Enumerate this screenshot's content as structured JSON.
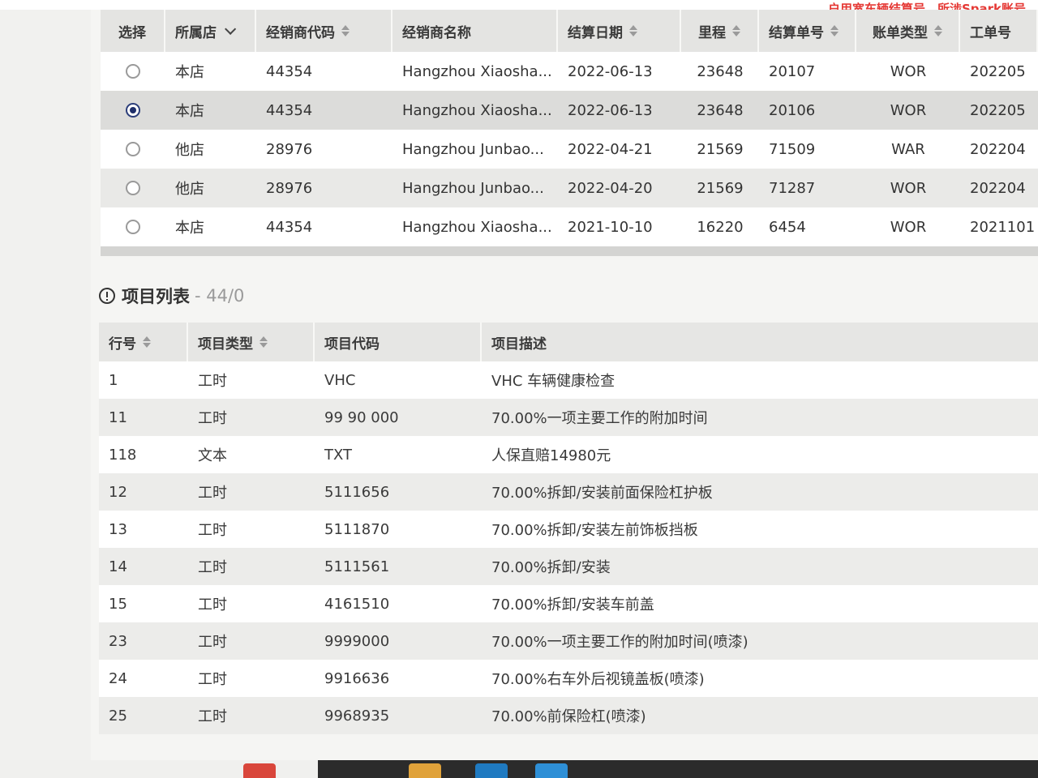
{
  "notice": "…户用宽车辆结算号，所涉Spark账号…",
  "settlement": {
    "columns": {
      "select": "选择",
      "store": "所属店",
      "dealer_code": "经销商代码",
      "dealer_name": "经销商名称",
      "settle_date": "结算日期",
      "mileage": "里程",
      "settle_no": "结算单号",
      "bill_type": "账单类型",
      "wo_no": "工单号"
    },
    "selected_index": 1,
    "rows": [
      {
        "store": "本店",
        "dealer_code": "44354",
        "dealer_name": "Hangzhou Xiaosha...",
        "settle_date": "2022-06-13",
        "mileage": "23648",
        "settle_no": "20107",
        "bill_type": "WOR",
        "wo_no": "202205"
      },
      {
        "store": "本店",
        "dealer_code": "44354",
        "dealer_name": "Hangzhou Xiaosha...",
        "settle_date": "2022-06-13",
        "mileage": "23648",
        "settle_no": "20106",
        "bill_type": "WOR",
        "wo_no": "202205"
      },
      {
        "store": "他店",
        "dealer_code": "28976",
        "dealer_name": "Hangzhou Junbao...",
        "settle_date": "2022-04-21",
        "mileage": "21569",
        "settle_no": "71509",
        "bill_type": "WAR",
        "wo_no": "202204"
      },
      {
        "store": "他店",
        "dealer_code": "28976",
        "dealer_name": "Hangzhou Junbao...",
        "settle_date": "2022-04-20",
        "mileage": "21569",
        "settle_no": "71287",
        "bill_type": "WOR",
        "wo_no": "202204"
      },
      {
        "store": "本店",
        "dealer_code": "44354",
        "dealer_name": "Hangzhou Xiaosha...",
        "settle_date": "2021-10-10",
        "mileage": "16220",
        "settle_no": "6454",
        "bill_type": "WOR",
        "wo_no": "2021101"
      }
    ]
  },
  "items": {
    "title": "项目列表",
    "count": "- 44/0",
    "columns": {
      "line_no": "行号",
      "item_type": "项目类型",
      "item_code": "项目代码",
      "item_desc": "项目描述"
    },
    "rows": [
      {
        "line_no": "1",
        "item_type": "工时",
        "item_code": "VHC",
        "item_desc": "VHC 车辆健康检查"
      },
      {
        "line_no": "11",
        "item_type": "工时",
        "item_code": "99 90 000",
        "item_desc": "70.00%一项主要工作的附加时间"
      },
      {
        "line_no": "118",
        "item_type": "文本",
        "item_code": "TXT",
        "item_desc": "人保直赔14980元"
      },
      {
        "line_no": "12",
        "item_type": "工时",
        "item_code": "5111656",
        "item_desc": "70.00%拆卸/安装前面保险杠护板"
      },
      {
        "line_no": "13",
        "item_type": "工时",
        "item_code": "5111870",
        "item_desc": "70.00%拆卸/安装左前饰板挡板"
      },
      {
        "line_no": "14",
        "item_type": "工时",
        "item_code": "5111561",
        "item_desc": "70.00%拆卸/安装"
      },
      {
        "line_no": "15",
        "item_type": "工时",
        "item_code": "4161510",
        "item_desc": "70.00%拆卸/安装车前盖"
      },
      {
        "line_no": "23",
        "item_type": "工时",
        "item_code": "9999000",
        "item_desc": "70.00%一项主要工作的附加时间(喷漆)"
      },
      {
        "line_no": "24",
        "item_type": "工时",
        "item_code": "9916636",
        "item_desc": "70.00%右车外后视镜盖板(喷漆)"
      },
      {
        "line_no": "25",
        "item_type": "工时",
        "item_code": "9968935",
        "item_desc": "70.00%前保险杠(喷漆)"
      }
    ]
  },
  "colors": {
    "notice_red": "#e53935",
    "selected_radio": "#1f2f6a",
    "header_bg": "#e4e4e2"
  }
}
